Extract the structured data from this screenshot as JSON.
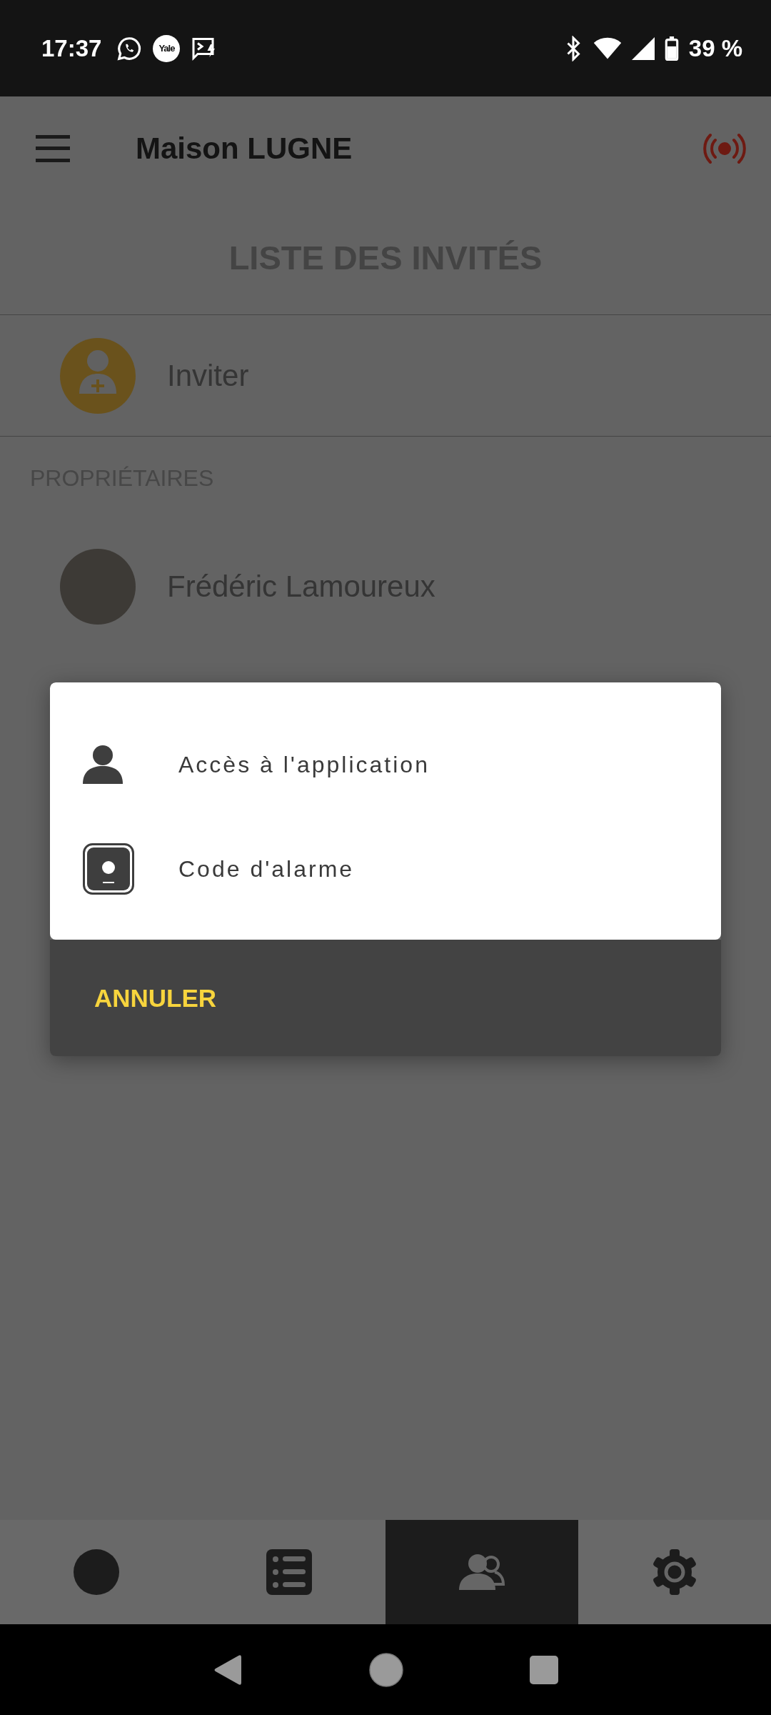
{
  "status_bar": {
    "time": "17:37",
    "app_badge": "Yale",
    "battery": "39 %"
  },
  "header": {
    "title": "Maison LUGNE"
  },
  "page_title": "LISTE DES INVITÉS",
  "invite": {
    "label": "Inviter"
  },
  "owners": {
    "heading": "PROPRIÉTAIRES",
    "people": [
      {
        "name": "Frédéric Lamoureux"
      }
    ]
  },
  "dialog": {
    "options": [
      {
        "kind": "person",
        "label": "Accès à l'application"
      },
      {
        "kind": "keypad",
        "label": "Code d'alarme"
      }
    ],
    "cancel": "ANNULER"
  },
  "bottom_nav": [
    {
      "kind": "status",
      "selected": false
    },
    {
      "kind": "list",
      "selected": false
    },
    {
      "kind": "guests",
      "selected": true
    },
    {
      "kind": "settings",
      "selected": false
    }
  ]
}
